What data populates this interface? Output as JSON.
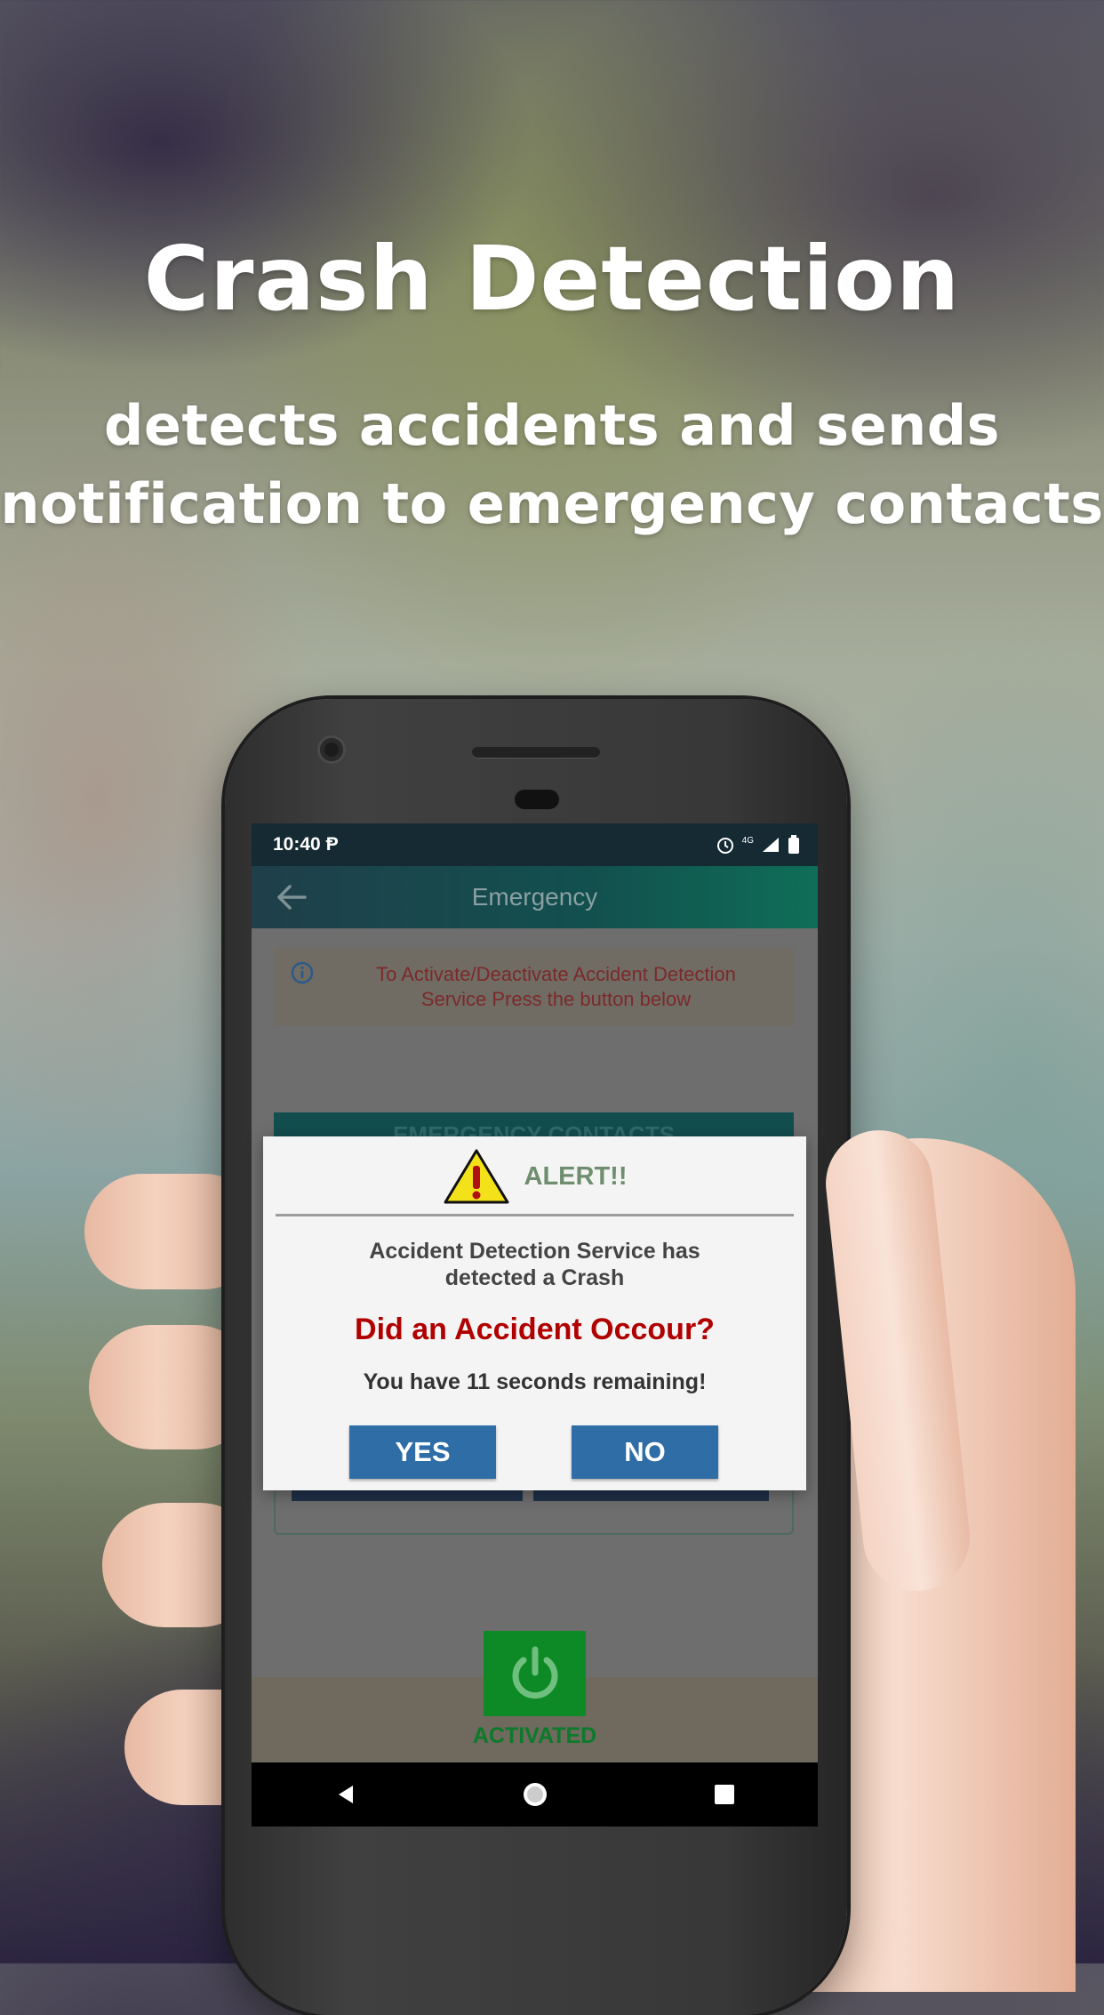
{
  "promo": {
    "title": "Crash Detection",
    "subtitle_line1": "detects accidents and sends",
    "subtitle_line2": "notification to emergency contacts"
  },
  "status_bar": {
    "time": "10:40",
    "network": "4G"
  },
  "app_bar": {
    "title": "Emergency",
    "back_icon": "arrow-left-icon"
  },
  "info": {
    "icon": "info-icon",
    "line1": "To Activate/Deactivate Accident Detection",
    "line2": "Service Press the button below"
  },
  "contacts_section": {
    "label": "EMERGENCY CONTACTS"
  },
  "dialog": {
    "icon": "warning-icon",
    "title": "ALERT!!",
    "message_line1": "Accident Detection Service has",
    "message_line2": "detected a Crash",
    "question": "Did an Accident Occour?",
    "countdown": "You have 11 seconds remaining!",
    "yes_label": "YES",
    "no_label": "NO"
  },
  "power": {
    "icon": "power-icon",
    "status": "ACTIVATED"
  },
  "colors": {
    "accent_teal": "#0f6e58",
    "button_blue": "#2f6da6",
    "alert_red": "#b00000",
    "active_green": "#0d8a25"
  }
}
